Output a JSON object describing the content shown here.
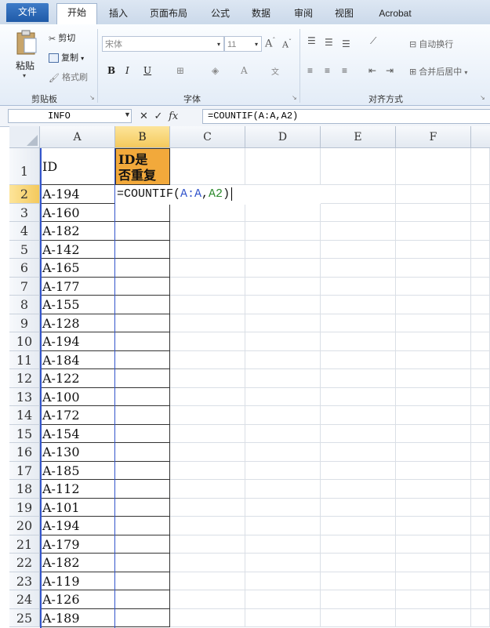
{
  "ribbon_tabs": [
    "文件",
    "开始",
    "插入",
    "页面布局",
    "公式",
    "数据",
    "审阅",
    "视图",
    "Acrobat"
  ],
  "clipboard": {
    "paste": "粘贴",
    "cut": "剪切",
    "copy": "复制",
    "format_painter": "格式刷",
    "label": "剪贴板"
  },
  "font": {
    "name": "宋体",
    "size": "11",
    "label": "字体"
  },
  "alignment": {
    "wrap_text": "自动换行",
    "merge_center": "合并后居中",
    "label": "对齐方式"
  },
  "formula_bar": {
    "name_box": "INFO",
    "formula": "=COUNTIF(A:A,A2)"
  },
  "columns": [
    "A",
    "B",
    "C",
    "D",
    "E",
    "F"
  ],
  "header_row": {
    "row": "1",
    "a": "ID",
    "b_line1": "ID是",
    "b_line2": "否重复"
  },
  "editing_cell": {
    "prefix": "=COUNTIF(",
    "ref1": "A:A",
    "comma": ",",
    "ref2": "A2",
    "suffix": ")"
  },
  "rows": [
    {
      "n": "2",
      "a": "A-194"
    },
    {
      "n": "3",
      "a": "A-160"
    },
    {
      "n": "4",
      "a": "A-182"
    },
    {
      "n": "5",
      "a": "A-142"
    },
    {
      "n": "6",
      "a": "A-165"
    },
    {
      "n": "7",
      "a": "A-177"
    },
    {
      "n": "8",
      "a": "A-155"
    },
    {
      "n": "9",
      "a": "A-128"
    },
    {
      "n": "10",
      "a": "A-194"
    },
    {
      "n": "11",
      "a": "A-184"
    },
    {
      "n": "12",
      "a": "A-122"
    },
    {
      "n": "13",
      "a": "A-100"
    },
    {
      "n": "14",
      "a": "A-172"
    },
    {
      "n": "15",
      "a": "A-154"
    },
    {
      "n": "16",
      "a": "A-130"
    },
    {
      "n": "17",
      "a": "A-185"
    },
    {
      "n": "18",
      "a": "A-112"
    },
    {
      "n": "19",
      "a": "A-101"
    },
    {
      "n": "20",
      "a": "A-194"
    },
    {
      "n": "21",
      "a": "A-179"
    },
    {
      "n": "22",
      "a": "A-182"
    },
    {
      "n": "23",
      "a": "A-119"
    },
    {
      "n": "24",
      "a": "A-126"
    },
    {
      "n": "25",
      "a": "A-189"
    }
  ]
}
